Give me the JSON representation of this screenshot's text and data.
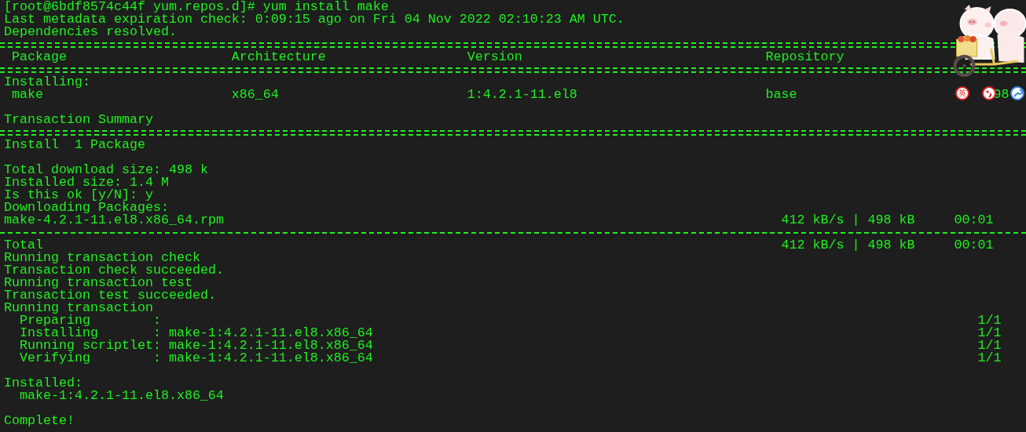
{
  "terminal": {
    "lines": [
      {
        "kind": "text",
        "text": "[root@6bdf8574c44f yum.repos.d]# yum install make"
      },
      {
        "kind": "text",
        "text": "Last metadata expiration check: 0:09:15 ago on Fri 04 Nov 2022 02:10:23 AM UTC."
      },
      {
        "kind": "text",
        "text": "Dependencies resolved."
      },
      {
        "kind": "double_rule"
      },
      {
        "kind": "table_header",
        "cells": [
          "Package",
          "Architecture",
          "Version",
          "Repository"
        ]
      },
      {
        "kind": "double_rule"
      },
      {
        "kind": "text",
        "text": "Installing:"
      },
      {
        "kind": "table_row",
        "cells": [
          "make",
          "x86_64",
          "1:4.2.1-11.el8",
          "base",
          "98"
        ]
      },
      {
        "kind": "blank"
      },
      {
        "kind": "text",
        "text": "Transaction Summary"
      },
      {
        "kind": "double_rule"
      },
      {
        "kind": "text",
        "text": "Install  1 Package"
      },
      {
        "kind": "blank"
      },
      {
        "kind": "text",
        "text": "Total download size: 498 k"
      },
      {
        "kind": "text",
        "text": "Installed size: 1.4 M"
      },
      {
        "kind": "text",
        "text": "Is this ok [y/N]: y"
      },
      {
        "kind": "text",
        "text": "Downloading Packages:"
      },
      {
        "kind": "download",
        "file": "make-4.2.1-11.el8.x86_64.rpm",
        "rate": "412 kB/s | 498 kB",
        "time": "00:01"
      },
      {
        "kind": "single_rule"
      },
      {
        "kind": "download",
        "file": "Total",
        "rate": "412 kB/s | 498 kB",
        "time": "00:01"
      },
      {
        "kind": "text",
        "text": "Running transaction check"
      },
      {
        "kind": "text",
        "text": "Transaction check succeeded."
      },
      {
        "kind": "text",
        "text": "Running transaction test"
      },
      {
        "kind": "text",
        "text": "Transaction test succeeded."
      },
      {
        "kind": "text",
        "text": "Running transaction"
      },
      {
        "kind": "step",
        "label": "Preparing",
        "separator": ":",
        "count": "1/1"
      },
      {
        "kind": "step",
        "label": "Installing",
        "separator": ":",
        "detail": "make-1:4.2.1-11.el8.x86_64",
        "count": "1/1"
      },
      {
        "kind": "step",
        "label": "Running scriptlet",
        "separator": ":",
        "detail": "make-1:4.2.1-11.el8.x86_64",
        "count": "1/1"
      },
      {
        "kind": "step",
        "label": "Verifying",
        "separator": ":",
        "detail": "make-1:4.2.1-11.el8.x86_64",
        "count": "1/1"
      },
      {
        "kind": "blank"
      },
      {
        "kind": "text",
        "text": "Installed:"
      },
      {
        "kind": "item",
        "text": "make-1:4.2.1-11.el8.x86_64"
      },
      {
        "kind": "blank"
      },
      {
        "kind": "text",
        "text": "Complete!"
      }
    ]
  },
  "ime_toolbar": {
    "language_label": "英"
  }
}
